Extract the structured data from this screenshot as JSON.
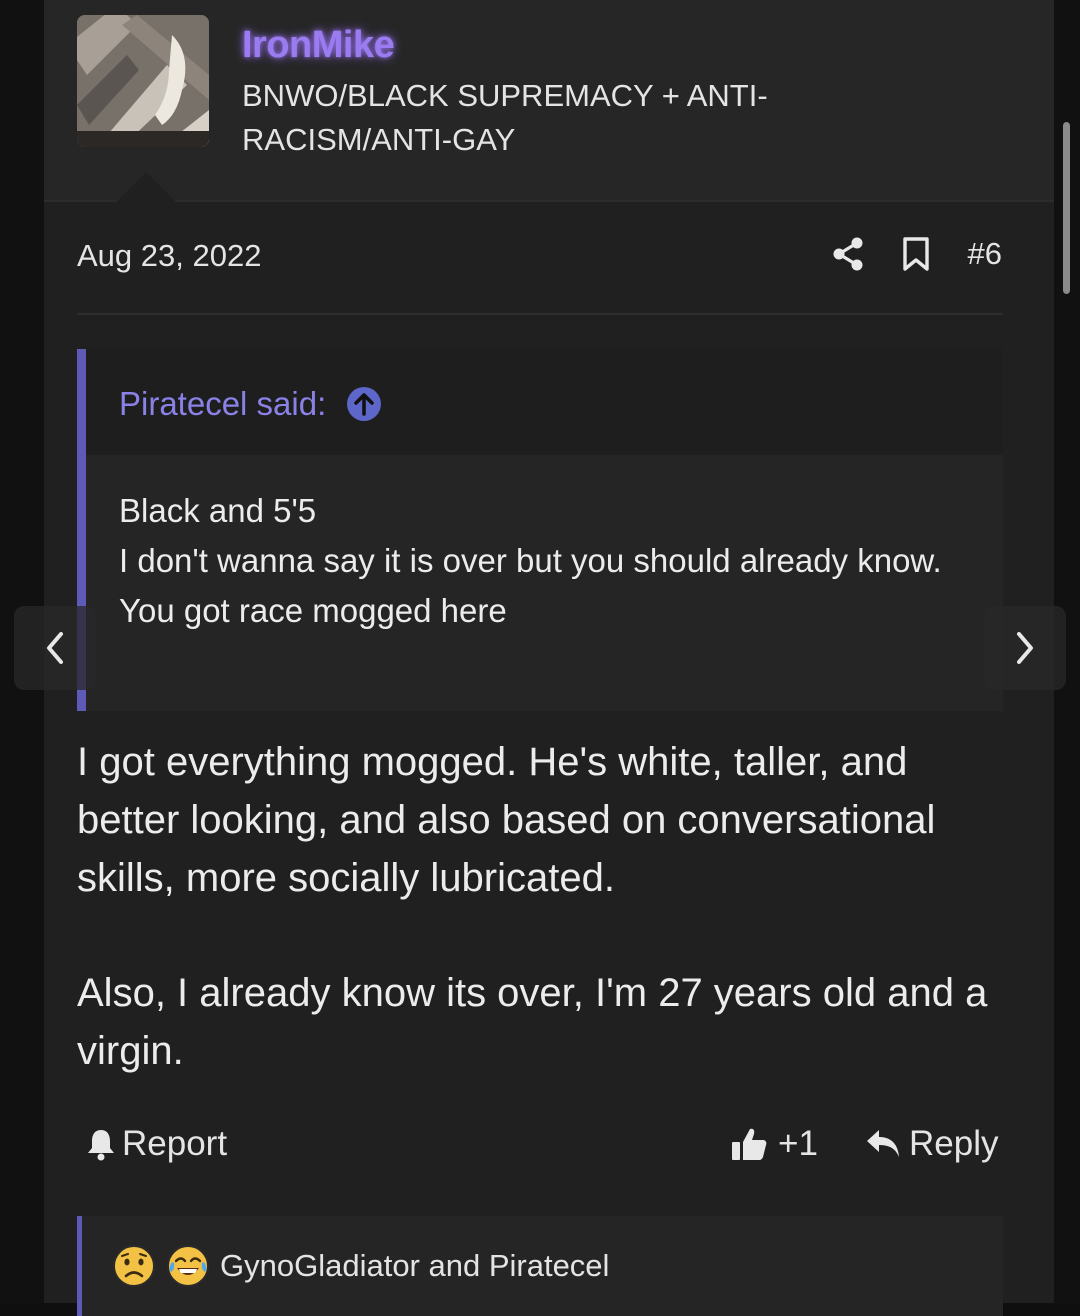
{
  "user": {
    "username": "IronMike",
    "title": "BNWO/BLACK SUPREMACY + ANTI-RACISM/ANTI-GAY",
    "avatar_icon": "avatar-image",
    "username_color": "#9b7bf0"
  },
  "post": {
    "date": "Aug 23, 2022",
    "number": "#6",
    "share_icon": "share-icon",
    "bookmark_icon": "bookmark-icon",
    "paragraphs": [
      "I got everything mogged. He's white, taller, and better looking, and also based on conversational skills, more socially lubricated.",
      "Also, I already know its over, I'm 27 years old and a virgin."
    ]
  },
  "quote": {
    "attribution": "Piratecel said:",
    "jump_icon": "arrow-up-circle-icon",
    "lines": [
      "Black and 5'5",
      "I don't wanna say it is over but you should already know.",
      "You got race mogged here"
    ],
    "accent_color": "#5d5ab8"
  },
  "actions": {
    "report_label": "Report",
    "like_count": "+1",
    "reply_label": "Reply"
  },
  "reactions": {
    "icons": [
      "sad-face-icon",
      "crying-laughing-icon"
    ],
    "text": "GynoGladiator and Piratecel"
  },
  "navigation": {
    "prev_icon": "chevron-left-icon",
    "next_icon": "chevron-right-icon"
  }
}
